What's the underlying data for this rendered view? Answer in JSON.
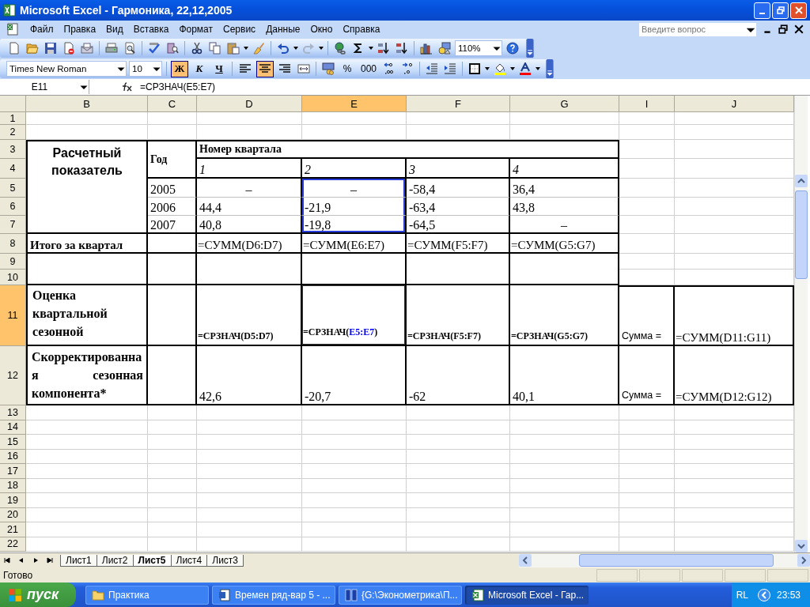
{
  "window": {
    "title": "Microsoft Excel - Гармоника, 22,12,2005"
  },
  "menu": [
    "Файл",
    "Правка",
    "Вид",
    "Вставка",
    "Формат",
    "Сервис",
    "Данные",
    "Окно",
    "Справка"
  ],
  "help_search": {
    "placeholder": "Введите вопрос"
  },
  "standard_toolbar": {
    "zoom": "110%"
  },
  "formatting_toolbar": {
    "font": "Times New Roman",
    "size": "10",
    "styles": [
      {
        "label": "Ж",
        "kind": "bold",
        "selected": true
      },
      {
        "label": "К",
        "kind": "italic",
        "selected": false
      },
      {
        "label": "Ч",
        "kind": "underline",
        "selected": false
      }
    ],
    "alignment": [
      {
        "kind": "left",
        "selected": false
      },
      {
        "kind": "center",
        "selected": true
      },
      {
        "kind": "right",
        "selected": false
      }
    ],
    "number_formats": [
      "%",
      "000"
    ]
  },
  "formula_bar": {
    "name_box": "E11",
    "formula": "=СРЗНАЧ(E5:E7)"
  },
  "sheet": {
    "columns": [
      {
        "label": "B",
        "selected": false
      },
      {
        "label": "C",
        "selected": false
      },
      {
        "label": "D",
        "selected": false
      },
      {
        "label": "E",
        "selected": true
      },
      {
        "label": "F",
        "selected": false
      },
      {
        "label": "G",
        "selected": false
      },
      {
        "label": "I",
        "selected": false
      },
      {
        "label": "J",
        "selected": false
      }
    ],
    "rows": [
      {
        "label": "1",
        "selected": false
      },
      {
        "label": "2",
        "selected": false
      },
      {
        "label": "3",
        "selected": false,
        "cells": [
          {
            "text": "Расчетный показатель",
            "kind": "heading-sans"
          },
          {
            "text": "Год",
            "kind": "heading"
          },
          {
            "text": "Номер квартала",
            "kind": "heading"
          },
          null,
          null,
          null,
          null,
          null
        ]
      },
      {
        "label": "4",
        "selected": false,
        "cells": [
          null,
          null,
          {
            "text": "1",
            "kind": "index"
          },
          {
            "text": "2",
            "kind": "index"
          },
          {
            "text": "3",
            "kind": "index"
          },
          {
            "text": "4",
            "kind": "index"
          },
          null,
          null
        ]
      },
      {
        "label": "5",
        "selected": false,
        "cells": [
          null,
          {
            "text": "2005",
            "kind": "value"
          },
          {
            "text": "–",
            "kind": "dash"
          },
          {
            "text": "–",
            "kind": "dash",
            "referenced": true
          },
          {
            "text": "-58,4",
            "kind": "value"
          },
          {
            "text": "36,4",
            "kind": "value"
          },
          null,
          null
        ]
      },
      {
        "label": "6",
        "selected": false,
        "cells": [
          null,
          {
            "text": "2006",
            "kind": "value"
          },
          {
            "text": "44,4",
            "kind": "value"
          },
          {
            "text": "-21,9",
            "kind": "value",
            "referenced": true
          },
          {
            "text": "-63,4",
            "kind": "value"
          },
          {
            "text": "43,8",
            "kind": "value"
          },
          null,
          null
        ]
      },
      {
        "label": "7",
        "selected": false,
        "cells": [
          null,
          {
            "text": "2007",
            "kind": "value"
          },
          {
            "text": "40,8",
            "kind": "value"
          },
          {
            "text": "-19,8",
            "kind": "value",
            "referenced": true
          },
          {
            "text": "-64,5",
            "kind": "value"
          },
          {
            "text": "–",
            "kind": "dash"
          },
          null,
          null
        ]
      },
      {
        "label": "8",
        "selected": false,
        "cells": [
          {
            "text": "Итого за квартал",
            "kind": "label"
          },
          null,
          {
            "text": "=СУММ(D6:D7)",
            "kind": "formula"
          },
          {
            "text": "=СУММ(E6:E7)",
            "kind": "formula"
          },
          {
            "text": "=СУММ(F5:F7)",
            "kind": "formula"
          },
          {
            "text": "=СУММ(G5:G7)",
            "kind": "formula"
          },
          null,
          null
        ]
      },
      {
        "label": "9",
        "selected": false
      },
      {
        "label": "10",
        "selected": false
      },
      {
        "label": "11",
        "selected": true,
        "cells": [
          {
            "text": "Оценка квартальной сезонной",
            "kind": "top-label"
          },
          null,
          {
            "text": "=СРЗНАЧ(D5:D7)",
            "kind": "small-formula"
          },
          {
            "text": "=СРЗНАЧ(E5:E7)",
            "kind": "editing-formula"
          },
          {
            "text": "=СРЗНАЧ(F5:F7)",
            "kind": "small-formula"
          },
          {
            "text": "=СРЗНАЧ(G5:G7)",
            "kind": "small-formula"
          },
          {
            "text": "Сумма =",
            "kind": "sum-label"
          },
          {
            "text": "=СУММ(D11:G11)",
            "kind": "formula"
          }
        ]
      },
      {
        "label": "12",
        "selected": false,
        "cells": [
          {
            "text": "Скорректированная сезонная компонента*",
            "kind": "justified-label"
          },
          null,
          {
            "text": "42,6",
            "kind": "value"
          },
          {
            "text": "-20,7",
            "kind": "value"
          },
          {
            "text": "-62",
            "kind": "value"
          },
          {
            "text": "40,1",
            "kind": "value"
          },
          {
            "text": "Сумма =",
            "kind": "sum-label"
          },
          {
            "text": "=СУММ(D12:G12)",
            "kind": "formula"
          }
        ]
      },
      {
        "label": "13",
        "selected": false
      },
      {
        "label": "14",
        "selected": false
      },
      {
        "label": "15",
        "selected": false
      },
      {
        "label": "16",
        "selected": false
      },
      {
        "label": "17",
        "selected": false
      },
      {
        "label": "18",
        "selected": false
      },
      {
        "label": "19",
        "selected": false
      },
      {
        "label": "20",
        "selected": false
      },
      {
        "label": "21",
        "selected": false
      },
      {
        "label": "22",
        "selected": false
      }
    ]
  },
  "sheet_tabs": [
    {
      "label": "Лист1",
      "selected": false
    },
    {
      "label": "Лист2",
      "selected": false
    },
    {
      "label": "Лист5",
      "selected": true
    },
    {
      "label": "Лист4",
      "selected": false
    },
    {
      "label": "Лист3",
      "selected": false
    }
  ],
  "status_bar": {
    "text": "Готово"
  },
  "taskbar": {
    "start": "пуск",
    "tasks": [
      {
        "label": "Практика",
        "kind": "folder",
        "selected": false
      },
      {
        "label": "Времен ряд-вар 5 - ...",
        "kind": "document",
        "selected": false
      },
      {
        "label": "{G:\\Эконометрика\\П...",
        "kind": "book",
        "selected": false
      },
      {
        "label": "Microsoft Excel - Гар...",
        "kind": "spreadsheet",
        "selected": true
      }
    ],
    "language": "RL",
    "clock": "23:53"
  }
}
